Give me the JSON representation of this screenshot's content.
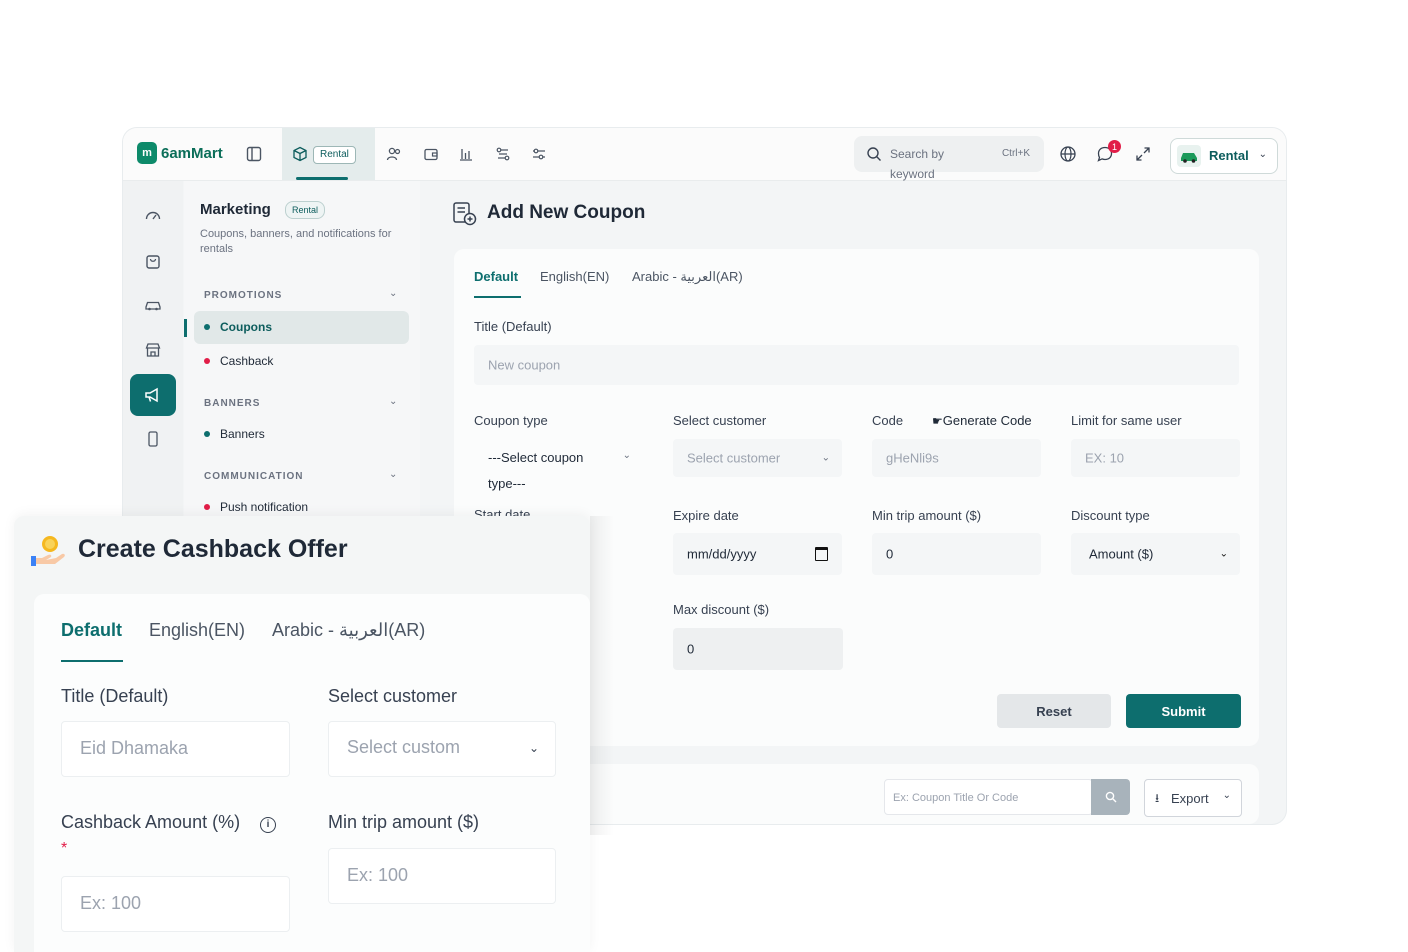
{
  "brand": {
    "name": "6amMart",
    "primary": "#0d6e6e"
  },
  "topbar": {
    "module_pill": "Rental",
    "search_placeholder": "Search by keyword",
    "search_shortcut": "Ctrl+K",
    "notification_count": "1",
    "module_button": "Rental",
    "icons": [
      "layout-icon",
      "box-icon",
      "users-icon",
      "wallet-icon",
      "chart-icon",
      "shuffle-icon",
      "sliders-icon",
      "search-icon",
      "globe-icon",
      "chat-icon",
      "expand-icon",
      "car-icon"
    ]
  },
  "menu": {
    "title": "Marketing",
    "pill": "Rental",
    "subtitle": "Coupons, banners, and notifications for rentals",
    "sections": [
      {
        "label": "PROMOTIONS",
        "items": [
          {
            "label": "Coupons",
            "dot": "#0d6e6e",
            "active": true
          },
          {
            "label": "Cashback",
            "dot": "#e11d48"
          }
        ]
      },
      {
        "label": "BANNERS",
        "items": [
          {
            "label": "Banners",
            "dot": "#0d6e6e"
          }
        ]
      },
      {
        "label": "COMMUNICATION",
        "items": [
          {
            "label": "Push notification",
            "dot": "#e11d48"
          }
        ]
      }
    ]
  },
  "coupon": {
    "title": "Add New Coupon",
    "tabs": [
      "Default",
      "English(EN)",
      "Arabic - العربية(AR)"
    ],
    "title_label": "Title (Default)",
    "title_placeholder": "New coupon",
    "coupon_type_label": "Coupon type",
    "coupon_type_value": "---Select coupon type---",
    "select_customer_label": "Select customer",
    "select_customer_placeholder": "Select customer",
    "code_label": "Code",
    "generate_code": "Generate Code",
    "code_placeholder": "gHeNli9s",
    "limit_label": "Limit for same user",
    "limit_placeholder": "EX: 10",
    "start_date_label": "Start date",
    "expire_label": "Expire date",
    "expire_value": "mm/dd/yyyy",
    "min_trip_label": "Min trip amount ($)",
    "min_trip_value": "0",
    "discount_type_label": "Discount type",
    "discount_type_value": "Amount ($)",
    "max_discount_label": "Max discount ($)",
    "max_discount_value": "0",
    "reset": "Reset",
    "submit": "Submit",
    "list_search_placeholder": "Ex: Coupon Title Or Code",
    "export": "Export"
  },
  "cashback": {
    "title": "Create Cashback Offer",
    "tabs": [
      "Default",
      "English(EN)",
      "Arabic - العربية(AR)"
    ],
    "title_label": "Title (Default)",
    "title_placeholder": "Eid Dhamaka",
    "select_customer_label": "Select customer",
    "select_customer_placeholder": "Select custom",
    "amount_label": "Cashback Amount (%)",
    "required_mark": "*",
    "amount_placeholder": "Ex: 100",
    "min_trip_label": "Min trip amount ($)",
    "min_trip_placeholder": "Ex: 100"
  }
}
